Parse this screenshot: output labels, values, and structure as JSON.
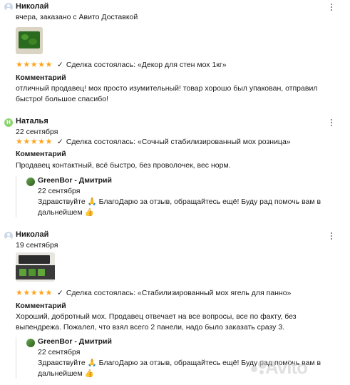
{
  "reviews": [
    {
      "name": "Николай",
      "date": "вчера, заказано с Авито Доставкой",
      "stars": "★★★★★",
      "deal": "Сделка состоялась: «Декор для стен мох 1кг»",
      "comment_label": "Комментарий",
      "comment": "отличный продавец! мох просто изумительный! товар хорошо был упакован, отправил быстро! большое спасибо!"
    },
    {
      "name": "Наталья",
      "avatar_letter": "Н",
      "date": "22 сентября",
      "stars": "★★★★★",
      "deal": "Сделка состоялась: «Сочный стабилизированный мох розница»",
      "comment_label": "Комментарий",
      "comment": "Продавец контактный, всё быстро, без проволочек, вес норм.",
      "reply": {
        "name": "GreenBor - Дмитрий",
        "date": "22 сентября",
        "text": "Здравствуйте 🙏 БлагоДарю за отзыв, обращайтесь ещё! Буду рад помочь вам в дальнейшем 👍"
      }
    },
    {
      "name": "Николай",
      "date": "19 сентября",
      "stars": "★★★★★",
      "deal": "Сделка состоялась: «Стабилизированный мох ягель для панно»",
      "comment_label": "Комментарий",
      "comment": "Хороший, добротный мох. Продавец отвечает на все вопросы, все по факту, без выпендрежа. Пожалел, что взял всего 2 панели, надо было заказать сразу 3.",
      "reply": {
        "name": "GreenBor - Дмитрий",
        "date": "22 сентября",
        "text": "Здравствуйте 🙏 БлагоДарю за отзыв, обращайтесь ещё! Буду рад помочь вам в дальнейшем 👍"
      }
    }
  ],
  "watermark": "Avito",
  "colors": {
    "star": "#ffa41b",
    "avatar_green": "#8cd46d",
    "avatar_blue": "#cdd8e8"
  }
}
